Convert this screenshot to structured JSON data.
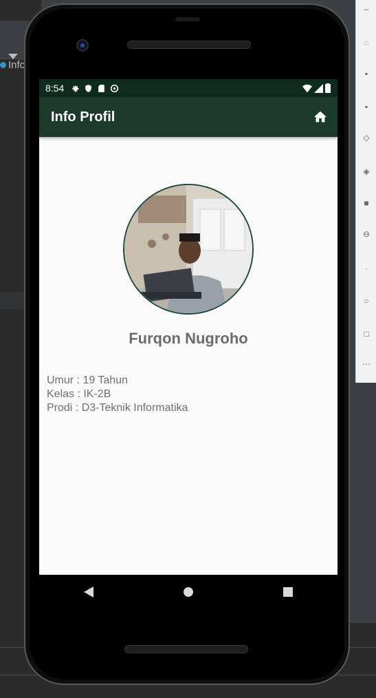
{
  "ide": {
    "tab_label": "Info"
  },
  "status_bar": {
    "time": "8:54"
  },
  "app_bar": {
    "title": "Info Profil",
    "home_icon": "home-icon"
  },
  "profile": {
    "name": "Furqon Nugroho",
    "info_lines": [
      "Umur : 19 Tahun",
      "Kelas : IK-2B",
      "Prodi : D3-Teknik Informatika"
    ]
  },
  "nav_bar": {
    "icons": [
      "back-icon",
      "home-circle-icon",
      "recents-icon"
    ]
  },
  "colors": {
    "status_bar": "#0f2a1e",
    "app_bar": "#1b3a2b",
    "avatar_border": "#1b4a3f",
    "text_gray": "#6b6b6b"
  }
}
